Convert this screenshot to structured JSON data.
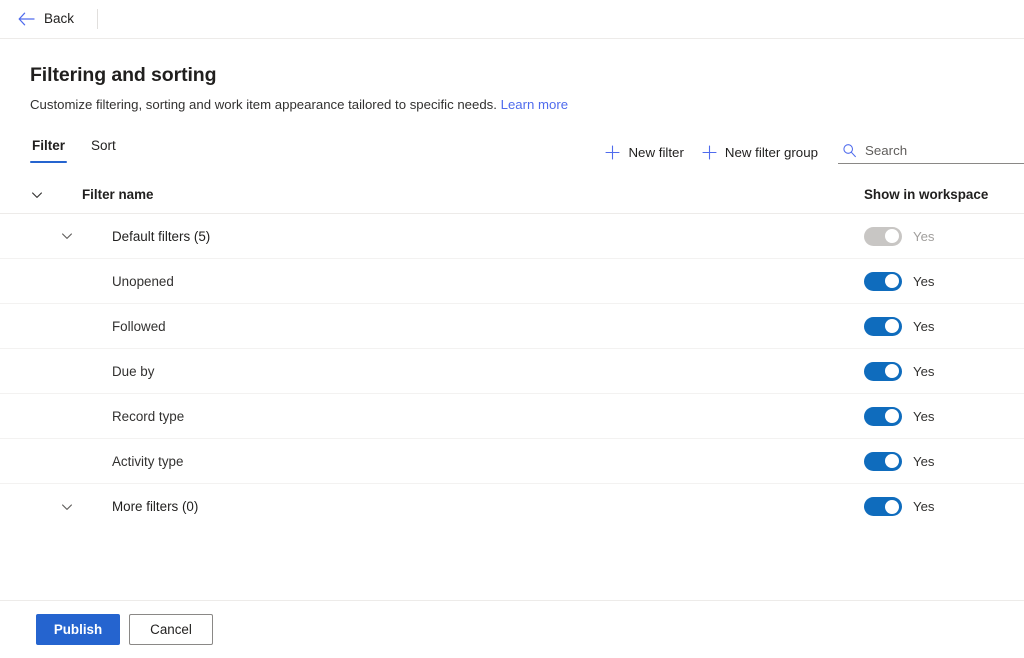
{
  "topbar": {
    "back_label": "Back",
    "back_icon": "arrow-left-icon"
  },
  "page": {
    "title": "Filtering and sorting",
    "subtitle": "Customize filtering, sorting and work item appearance tailored to specific needs.",
    "learn_more_label": "Learn more"
  },
  "tabs": [
    {
      "label": "Filter",
      "selected": true
    },
    {
      "label": "Sort",
      "selected": false
    }
  ],
  "actions": {
    "new_filter_label": "New filter",
    "new_filter_group_label": "New filter group",
    "plus_icon": "plus-icon",
    "search_icon": "search-icon"
  },
  "search": {
    "value": "",
    "placeholder": "Search"
  },
  "table": {
    "columns": {
      "name": "Filter name",
      "show_in_workspace": "Show in workspace"
    },
    "rows": [
      {
        "name": "Default filters (5)",
        "level": "group",
        "has_chevron": true,
        "toggle_on": true,
        "toggle_disabled": true,
        "toggle_label": "Yes"
      },
      {
        "name": "Unopened",
        "level": "child",
        "has_chevron": false,
        "toggle_on": true,
        "toggle_disabled": false,
        "toggle_label": "Yes"
      },
      {
        "name": "Followed",
        "level": "child",
        "has_chevron": false,
        "toggle_on": true,
        "toggle_disabled": false,
        "toggle_label": "Yes"
      },
      {
        "name": "Due by",
        "level": "child",
        "has_chevron": false,
        "toggle_on": true,
        "toggle_disabled": false,
        "toggle_label": "Yes"
      },
      {
        "name": "Record type",
        "level": "child",
        "has_chevron": false,
        "toggle_on": true,
        "toggle_disabled": false,
        "toggle_label": "Yes"
      },
      {
        "name": "Activity type",
        "level": "child",
        "has_chevron": false,
        "toggle_on": true,
        "toggle_disabled": false,
        "toggle_label": "Yes"
      },
      {
        "name": "More filters (0)",
        "level": "group",
        "has_chevron": true,
        "toggle_on": true,
        "toggle_disabled": false,
        "toggle_label": "Yes"
      }
    ]
  },
  "footer": {
    "publish_label": "Publish",
    "cancel_label": "Cancel"
  },
  "colors": {
    "accent": "#2564cf",
    "toggle_on": "#0f6cbd",
    "toggle_disabled": "#c8c6c4",
    "link": "#4f6bed"
  }
}
